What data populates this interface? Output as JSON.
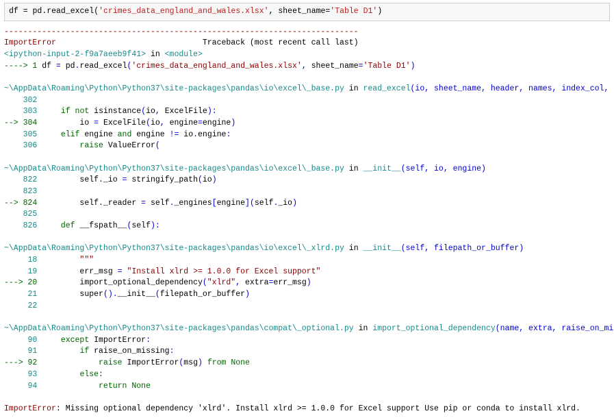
{
  "cell": {
    "prefix": "df = pd.read_excel(",
    "arg_file": "'crimes_data_england_and_wales.xlsx'",
    "mid": ", sheet_name=",
    "arg_sheet": "'Table D1'",
    "suffix": ")"
  },
  "dash_line": "---------------------------------------------------------------------------",
  "err_header_name": "ImportError",
  "err_header_spaces": "                               ",
  "err_header_trace": "Traceback (most recent call last)",
  "frame_top_1a": "<ipython-input-2-f9a7aeeb9f41>",
  "frame_top_1b": " in ",
  "frame_top_1c": "<module>",
  "frame_top_2a": "----> 1",
  "frame_top_2b": " df ",
  "frame_top_2c": "=",
  "frame_top_2d": " pd",
  "frame_top_2e": ".",
  "frame_top_2f": "read_excel",
  "frame_top_2g": "(",
  "frame_top_2h": "'crimes_data_england_and_wales.xlsx'",
  "frame_top_2i": ",",
  "frame_top_2j": " sheet_name",
  "frame_top_2k": "=",
  "frame_top_2l": "'Table D1'",
  "frame_top_2m": ")",
  "f1_path": "~\\AppData\\Roaming\\Python\\Python37\\site-packages\\pandas\\io\\excel\\_base.py",
  "f1_in": " in ",
  "f1_func": "read_excel",
  "f1_sig": "(io, sheet_name, header, names, index_col, usecols, squeeze, dtype, engine, converters, true_values, false_values, skiprows, nrows, na_values, keep_default_na, verbose, parse_dates, date_parser, thousands, comment, skipfooter, convert_float, mangle_dupe_cols, **kwds)",
  "f1_302_no": "    302",
  "f1_302_code": " ",
  "f1_303_no": "    303",
  "f1_303_a": "     ",
  "f1_303_if": "if",
  "f1_303_b": " ",
  "f1_303_not": "not",
  "f1_303_c": " isinstance",
  "f1_303_d": "(",
  "f1_303_e": "io",
  "f1_303_f": ",",
  "f1_303_g": " ExcelFile",
  "f1_303_h": ")",
  "f1_303_i": ":",
  "f1_304_arrow": "--> 304",
  "f1_304_a": "         io ",
  "f1_304_eq": "=",
  "f1_304_b": " ExcelFile",
  "f1_304_c": "(",
  "f1_304_d": "io",
  "f1_304_e": ",",
  "f1_304_f": " engine",
  "f1_304_g": "=",
  "f1_304_h": "engine",
  "f1_304_i": ")",
  "f1_305_no": "    305",
  "f1_305_a": "     ",
  "f1_305_elif": "elif",
  "f1_305_b": " engine ",
  "f1_305_and": "and",
  "f1_305_c": " engine ",
  "f1_305_ne": "!=",
  "f1_305_d": " io",
  "f1_305_e": ".",
  "f1_305_f": "engine",
  "f1_305_g": ":",
  "f1_306_no": "    306",
  "f1_306_a": "         ",
  "f1_306_raise": "raise",
  "f1_306_b": " ValueError",
  "f1_306_c": "(",
  "f2_path": "~\\AppData\\Roaming\\Python\\Python37\\site-packages\\pandas\\io\\excel\\_base.py",
  "f2_in": " in ",
  "f2_func": "__init__",
  "f2_sig": "(self, io, engine)",
  "f2_822_no": "    822",
  "f2_822_a": "         self",
  "f2_822_b": ".",
  "f2_822_c": "_io ",
  "f2_822_d": "=",
  "f2_822_e": " stringify_path",
  "f2_822_f": "(",
  "f2_822_g": "io",
  "f2_822_h": ")",
  "f2_823_no": "    823",
  "f2_823_a": " ",
  "f2_824_arrow": "--> 824",
  "f2_824_a": "         self",
  "f2_824_b": ".",
  "f2_824_c": "_reader ",
  "f2_824_d": "=",
  "f2_824_e": " self",
  "f2_824_f": ".",
  "f2_824_g": "_engines",
  "f2_824_h": "[",
  "f2_824_i": "engine",
  "f2_824_j": "]",
  "f2_824_k": "(",
  "f2_824_l": "self",
  "f2_824_m": ".",
  "f2_824_n": "_io",
  "f2_824_o": ")",
  "f2_825_no": "    825",
  "f2_825_a": " ",
  "f2_826_no": "    826",
  "f2_826_a": "     ",
  "f2_826_def": "def",
  "f2_826_b": " __fspath__",
  "f2_826_c": "(",
  "f2_826_d": "self",
  "f2_826_e": ")",
  "f2_826_f": ":",
  "f3_path": "~\\AppData\\Roaming\\Python\\Python37\\site-packages\\pandas\\io\\excel\\_xlrd.py",
  "f3_in": " in ",
  "f3_func": "__init__",
  "f3_sig": "(self, filepath_or_buffer)",
  "f3_18_no": "     18",
  "f3_18_a": "         \"\"\"",
  "f3_19_no": "     19",
  "f3_19_a": "         err_msg ",
  "f3_19_b": "=",
  "f3_19_c": " ",
  "f3_19_d": "\"Install xlrd >= 1.0.0 for Excel support\"",
  "f3_20_arrow": "---> 20",
  "f3_20_a": "         import_optional_dependency",
  "f3_20_b": "(",
  "f3_20_c": "\"xlrd\"",
  "f3_20_d": ",",
  "f3_20_e": " extra",
  "f3_20_f": "=",
  "f3_20_g": "err_msg",
  "f3_20_h": ")",
  "f3_21_no": "     21",
  "f3_21_a": "         super",
  "f3_21_b": "(",
  "f3_21_c": ")",
  "f3_21_d": ".",
  "f3_21_e": "__init__",
  "f3_21_f": "(",
  "f3_21_g": "filepath_or_buffer",
  "f3_21_h": ")",
  "f3_22_no": "     22",
  "f3_22_a": " ",
  "f4_path": "~\\AppData\\Roaming\\Python\\Python37\\site-packages\\pandas\\compat\\_optional.py",
  "f4_in": " in ",
  "f4_func": "import_optional_dependency",
  "f4_sig": "(name, extra, raise_on_missing, on_version)",
  "f4_90_no": "     90",
  "f4_90_a": "     ",
  "f4_90_except": "except",
  "f4_90_b": " ImportError",
  "f4_90_c": ":",
  "f4_91_no": "     91",
  "f4_91_a": "         ",
  "f4_91_if": "if",
  "f4_91_b": " raise_on_missing",
  "f4_91_c": ":",
  "f4_92_arrow": "---> 92",
  "f4_92_a": "             ",
  "f4_92_raise": "raise",
  "f4_92_b": " ImportError",
  "f4_92_c": "(",
  "f4_92_d": "msg",
  "f4_92_e": ")",
  "f4_92_f": " ",
  "f4_92_from": "from",
  "f4_92_g": " ",
  "f4_92_none": "None",
  "f4_93_no": "     93",
  "f4_93_a": "         ",
  "f4_93_else": "else",
  "f4_93_b": ":",
  "f4_94_no": "     94",
  "f4_94_a": "             ",
  "f4_94_return": "return",
  "f4_94_b": " ",
  "f4_94_none": "None",
  "final_name": "ImportError",
  "final_msg": ": Missing optional dependency 'xlrd'. Install xlrd >= 1.0.0 for Excel support Use pip or conda to install xlrd."
}
